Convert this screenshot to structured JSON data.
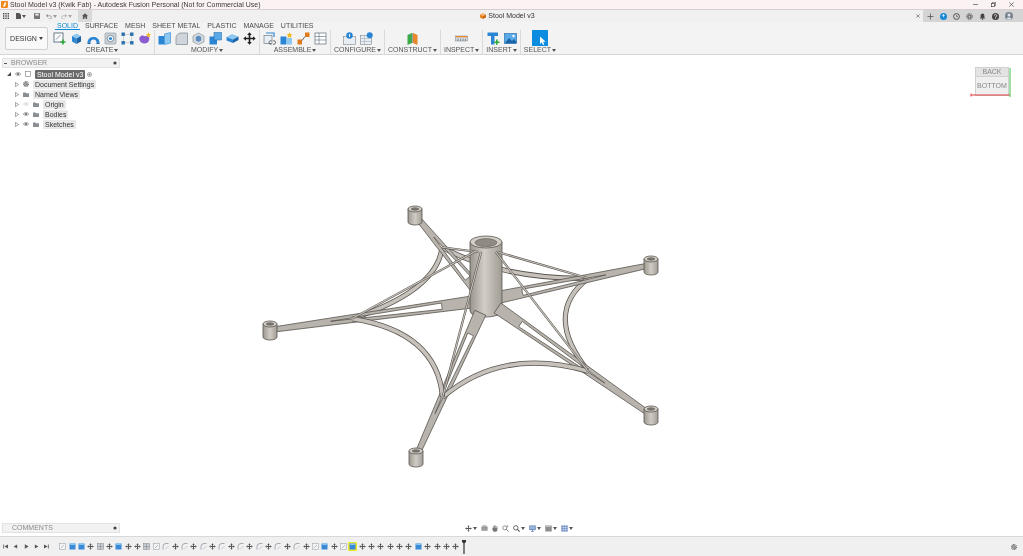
{
  "title_bar": {
    "title": "Stool Model v3 (Kwik Fab) - Autodesk Fusion Personal (Not for Commercial Use)"
  },
  "document_tab": {
    "title": "Stool Model v3"
  },
  "workspace": {
    "label": "DESIGN"
  },
  "toolbar_tabs": [
    {
      "label": "SOLID",
      "selected": true
    },
    {
      "label": "SURFACE",
      "selected": false
    },
    {
      "label": "MESH",
      "selected": false
    },
    {
      "label": "SHEET METAL",
      "selected": false
    },
    {
      "label": "PLASTIC",
      "selected": false
    },
    {
      "label": "MANAGE",
      "selected": false
    },
    {
      "label": "UTILITIES",
      "selected": false
    }
  ],
  "tool_groups": [
    {
      "label": "CREATE",
      "tools": [
        {
          "kind": "sketch"
        },
        {
          "kind": "extrude"
        },
        {
          "kind": "revolve"
        },
        {
          "kind": "hole"
        },
        {
          "kind": "pattern"
        },
        {
          "kind": "form"
        }
      ]
    },
    {
      "label": "MODIFY",
      "tools": [
        {
          "kind": "presspull"
        },
        {
          "kind": "fillet"
        },
        {
          "kind": "shell"
        },
        {
          "kind": "combine"
        },
        {
          "kind": "offset"
        },
        {
          "kind": "move"
        }
      ]
    },
    {
      "label": "ASSEMBLE",
      "tools": [
        {
          "kind": "component"
        },
        {
          "kind": "joint"
        },
        {
          "kind": "asbuilt"
        },
        {
          "kind": "table"
        }
      ]
    },
    {
      "label": "CONFIGURE",
      "tools": [
        {
          "kind": "parameters"
        },
        {
          "kind": "configure"
        }
      ]
    },
    {
      "label": "CONSTRUCT",
      "tools": [
        {
          "kind": "plane"
        }
      ]
    },
    {
      "label": "INSPECT",
      "tools": [
        {
          "kind": "measure"
        }
      ]
    },
    {
      "label": "INSERT",
      "tools": [
        {
          "kind": "derive"
        },
        {
          "kind": "image"
        }
      ]
    },
    {
      "label": "SELECT",
      "tools": [
        {
          "kind": "select"
        }
      ]
    }
  ],
  "browser": {
    "title": "BROWSER",
    "tree": [
      {
        "label": "Stool Model v3",
        "kind": "document",
        "expanded": true,
        "selected": true,
        "visible": true,
        "children": [
          {
            "label": "Document Settings",
            "kind": "settings",
            "expanded": false,
            "selected": false
          },
          {
            "label": "Named Views",
            "kind": "folder",
            "expanded": false,
            "selected": false
          },
          {
            "label": "Origin",
            "kind": "folder",
            "expanded": false,
            "selected": false,
            "visible": false
          },
          {
            "label": "Bodies",
            "kind": "folder",
            "expanded": false,
            "selected": false,
            "visible": true
          },
          {
            "label": "Sketches",
            "kind": "folder",
            "expanded": false,
            "selected": false,
            "visible": true
          }
        ]
      }
    ]
  },
  "view_cube": {
    "top": "BACK",
    "front": "BOTTOM"
  },
  "comments": {
    "title": "COMMENTS"
  },
  "timeline": {
    "items": [
      {
        "kind": "sketch",
        "selected": false
      },
      {
        "kind": "extrude",
        "selected": false
      },
      {
        "kind": "extrude",
        "selected": false
      },
      {
        "kind": "move",
        "selected": false
      },
      {
        "kind": "split",
        "selected": false
      },
      {
        "kind": "move",
        "selected": false
      },
      {
        "kind": "extrude",
        "selected": false
      },
      {
        "kind": "move",
        "selected": false
      },
      {
        "kind": "move",
        "selected": false
      },
      {
        "kind": "split",
        "selected": false
      },
      {
        "kind": "sketch",
        "selected": false
      },
      {
        "kind": "fillet",
        "selected": false
      },
      {
        "kind": "move",
        "selected": false
      },
      {
        "kind": "fillet",
        "selected": false
      },
      {
        "kind": "move",
        "selected": false
      },
      {
        "kind": "fillet",
        "selected": false
      },
      {
        "kind": "move",
        "selected": false
      },
      {
        "kind": "fillet",
        "selected": false
      },
      {
        "kind": "move",
        "selected": false
      },
      {
        "kind": "fillet",
        "selected": false
      },
      {
        "kind": "move",
        "selected": false
      },
      {
        "kind": "fillet",
        "selected": false
      },
      {
        "kind": "move",
        "selected": false
      },
      {
        "kind": "fillet",
        "selected": false
      },
      {
        "kind": "move",
        "selected": false
      },
      {
        "kind": "fillet",
        "selected": false
      },
      {
        "kind": "move",
        "selected": false
      },
      {
        "kind": "sketch",
        "selected": false
      },
      {
        "kind": "extrude",
        "selected": false
      },
      {
        "kind": "move",
        "selected": false
      },
      {
        "kind": "sketch",
        "selected": false
      },
      {
        "kind": "extrude",
        "selected": true
      },
      {
        "kind": "move",
        "selected": false
      },
      {
        "kind": "move",
        "selected": false
      },
      {
        "kind": "move",
        "selected": false
      },
      {
        "kind": "move",
        "selected": false
      },
      {
        "kind": "move",
        "selected": false
      },
      {
        "kind": "move",
        "selected": false
      },
      {
        "kind": "extrude",
        "selected": false
      },
      {
        "kind": "move",
        "selected": false
      },
      {
        "kind": "move",
        "selected": false
      },
      {
        "kind": "move",
        "selected": false
      },
      {
        "kind": "move",
        "selected": false
      }
    ]
  }
}
